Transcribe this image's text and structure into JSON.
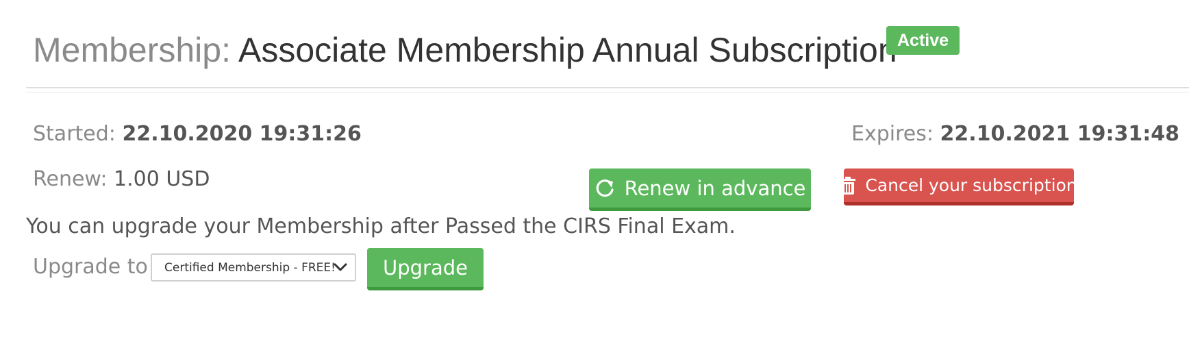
{
  "header": {
    "label": "Membership:",
    "title": "Associate Membership Annual Subscription",
    "status": "Active"
  },
  "details": {
    "started_label": "Started:",
    "started_value": "22.10.2020 19:31:26",
    "renew_label": "Renew:",
    "renew_value": "1.00 USD",
    "expires_label": "Expires:",
    "expires_value": "22.10.2021 19:31:48"
  },
  "actions": {
    "renew_label": "Renew in advance",
    "renew_icon": "refresh-icon",
    "cancel_label": "Cancel your subscription",
    "cancel_icon": "trash-icon"
  },
  "upgrade": {
    "note": "You can upgrade your Membership after Passed the CIRS Final Exam.",
    "label": "Upgrade to",
    "selected_option": "Certified Membership - FREE!",
    "button_label": "Upgrade"
  },
  "colors": {
    "success": "#5cb85c",
    "danger": "#d9534f",
    "muted_text": "#8a8a8a",
    "body_text": "#555555"
  }
}
